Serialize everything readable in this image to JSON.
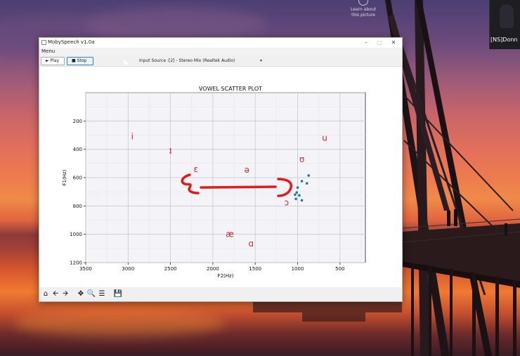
{
  "desktop": {
    "top_icon_label": "Learn about this picture",
    "participant_name": "[NS]Donn"
  },
  "window": {
    "title": "MobySpeech v1.0a",
    "menu_label": "Menu",
    "play_label": "► Play",
    "stop_label": "■ Stop",
    "input_source_label": "Input Source :",
    "input_source_value": "[2] - Stereo Mix (Realtek Audio)",
    "select_arrow": "▾"
  },
  "nav_toolbar": {
    "icons": [
      "home-icon",
      "back-arrow-icon",
      "forward-arrow-icon",
      "pan-icon",
      "zoom-icon",
      "configure-subplots-icon",
      "save-icon"
    ]
  },
  "chart_data": {
    "type": "scatter",
    "title": "VOWEL SCATTER PLOT",
    "xlabel": "F2(Hz)",
    "ylabel": "F1(Hz)",
    "xlim": [
      3500,
      200
    ],
    "ylim": [
      1200,
      0
    ],
    "x_ticks": [
      3500,
      3000,
      2500,
      2000,
      1500,
      1000,
      500
    ],
    "y_ticks": [
      200,
      400,
      600,
      800,
      1000,
      1200
    ],
    "grid": true,
    "vowel_labels": [
      {
        "symbol": "i",
        "f2": 2950,
        "f1": 310
      },
      {
        "symbol": "ɪ",
        "f2": 2500,
        "f1": 410
      },
      {
        "symbol": "ɛ",
        "f2": 2200,
        "f1": 540
      },
      {
        "symbol": "ə",
        "f2": 1600,
        "f1": 545
      },
      {
        "symbol": "ʊ",
        "f2": 950,
        "f1": 470
      },
      {
        "symbol": "u",
        "f2": 680,
        "f1": 320
      },
      {
        "symbol": "ɔ",
        "f2": 1130,
        "f1": 775
      },
      {
        "symbol": "æ",
        "f2": 1800,
        "f1": 1000
      },
      {
        "symbol": "ɑ",
        "f2": 1550,
        "f1": 1065
      }
    ],
    "points": [
      {
        "f2": 870,
        "f1": 585
      },
      {
        "f2": 950,
        "f1": 625
      },
      {
        "f2": 890,
        "f1": 640
      },
      {
        "f2": 1000,
        "f1": 670
      },
      {
        "f2": 1010,
        "f1": 705
      },
      {
        "f2": 1030,
        "f1": 720
      },
      {
        "f2": 980,
        "f1": 725
      },
      {
        "f2": 1020,
        "f1": 750
      },
      {
        "f2": 950,
        "f1": 760
      }
    ],
    "colors": {
      "vowel": "#d62728",
      "point": "#1f77b4",
      "annotation": "#e31a1c",
      "axes_bg": "#eaeaf2"
    }
  }
}
